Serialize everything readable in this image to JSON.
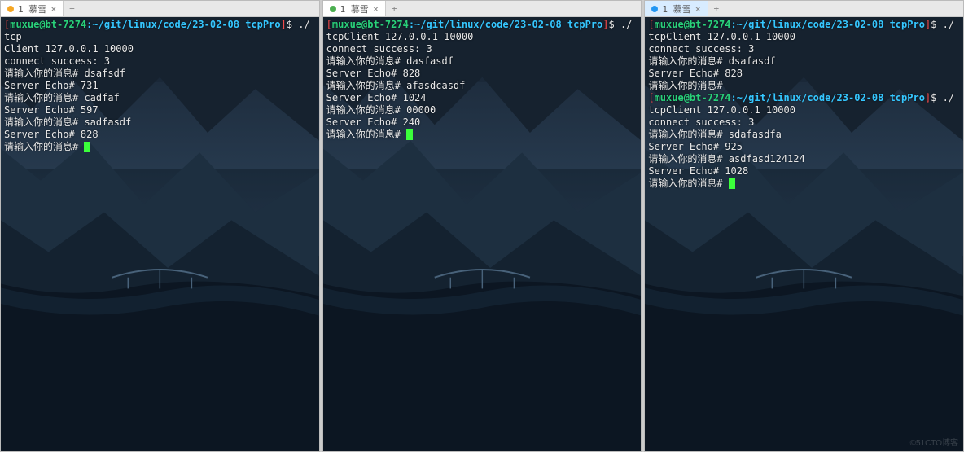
{
  "prompt": {
    "user": "muxue@bt-7274",
    "path": "~/git/linux/code/23-02-08",
    "dir": "tcpPro",
    "bracket_open": "[",
    "bracket_close": "]",
    "dollar": "$"
  },
  "common": {
    "tab_title": "1 慕雪",
    "close_glyph": "×",
    "add_glyph": "+",
    "input_prompt": "请输入你的消息#",
    "connect_line": "connect success: 3",
    "cmd_prefix": "./tcpClient 127.0.0.1 10000",
    "cmd_left_short": "./tcp",
    "cmd_mid_short": "./",
    "client_line": "Client 127.0.0.1 10000",
    "tcp_client_line": "tcpClient 127.0.0.1 10000",
    "echo_label": "Server Echo#"
  },
  "panes": [
    {
      "dot": "orange",
      "active": false,
      "lines": [
        {
          "t": "prompt",
          "cmd": "cmd_left_short"
        },
        {
          "t": "plain",
          "key": "client_line"
        },
        {
          "t": "plain",
          "key": "connect_line"
        },
        {
          "t": "input",
          "k": "l0_i1"
        },
        {
          "t": "echo",
          "k": "l0_e1"
        },
        {
          "t": "input",
          "k": "l0_i2"
        },
        {
          "t": "echo",
          "k": "l0_e2"
        },
        {
          "t": "input",
          "k": "l0_i3"
        },
        {
          "t": "echo",
          "k": "l0_e3"
        },
        {
          "t": "cursor"
        }
      ]
    },
    {
      "dot": "green",
      "active": false,
      "lines": [
        {
          "t": "prompt",
          "cmd": "cmd_mid_short"
        },
        {
          "t": "plain",
          "key": "tcp_client_line"
        },
        {
          "t": "plain",
          "key": "connect_line"
        },
        {
          "t": "input",
          "k": "l1_i1"
        },
        {
          "t": "echo",
          "k": "l1_e1"
        },
        {
          "t": "input",
          "k": "l1_i2"
        },
        {
          "t": "echo",
          "k": "l1_e2"
        },
        {
          "t": "input",
          "k": "l1_i3"
        },
        {
          "t": "echo",
          "k": "l1_e3"
        },
        {
          "t": "cursor"
        }
      ]
    },
    {
      "dot": "blue",
      "active": true,
      "lines": [
        {
          "t": "prompt",
          "cmd": "cmd_prefix"
        },
        {
          "t": "plain",
          "key": "connect_line"
        },
        {
          "t": "input",
          "k": "l2_i1"
        },
        {
          "t": "echo",
          "k": "l2_e1"
        },
        {
          "t": "input_empty"
        },
        {
          "t": "prompt",
          "cmd": "cmd_prefix"
        },
        {
          "t": "plain",
          "key": "connect_line"
        },
        {
          "t": "input",
          "k": "l2_i2"
        },
        {
          "t": "echo",
          "k": "l2_e2"
        },
        {
          "t": "input",
          "k": "l2_i3"
        },
        {
          "t": "echo",
          "k": "l2_e3"
        },
        {
          "t": "cursor"
        }
      ]
    }
  ],
  "values": {
    "l0_i1": "dsafsdf",
    "l0_e1": "731",
    "l0_i2": "cadfaf",
    "l0_e2": "597",
    "l0_i3": "sadfasdf",
    "l0_e3": "828",
    "l1_i1": "dasfasdf",
    "l1_e1": "828",
    "l1_i2": "afasdcasdf",
    "l1_e2": "1024",
    "l1_i3": "00000",
    "l1_e3": "240",
    "l2_i1": "dsafasdf",
    "l2_e1": "828",
    "l2_i2": "sdafasdfa",
    "l2_e2": "925",
    "l2_i3": "asdfasd124124",
    "l2_e3": "1028"
  },
  "watermark": "©51CTO博客"
}
